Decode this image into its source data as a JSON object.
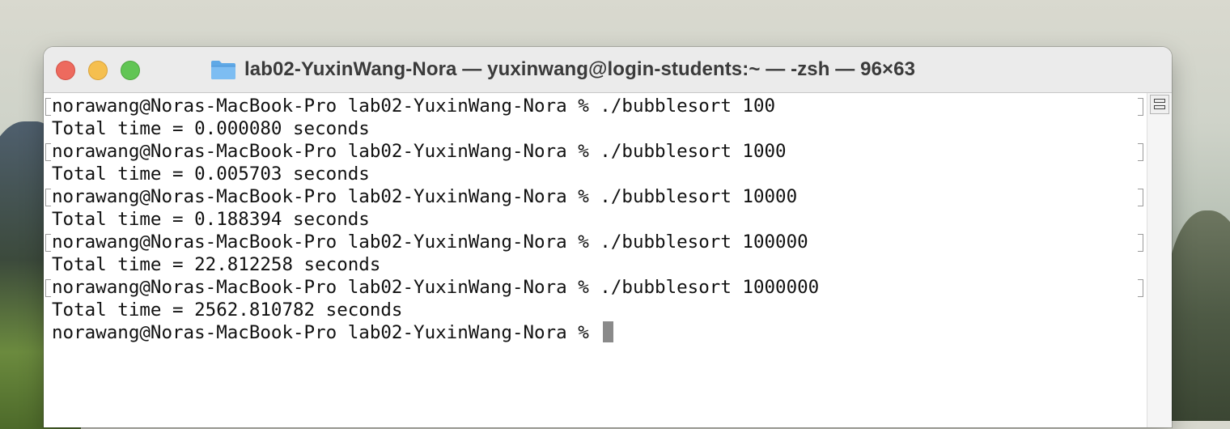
{
  "window": {
    "title": "lab02-YuxinWang-Nora — yuxinwang@login-students:~ — -zsh — 96×63",
    "folder_icon": "folder-icon",
    "traffic_lights": {
      "close_color": "#ed6a5e",
      "minimize_color": "#f5bf4f",
      "zoom_color": "#61c554"
    }
  },
  "terminal": {
    "lines": [
      {
        "text": "norawang@Noras-MacBook-Pro lab02-YuxinWang-Nora % ./bubblesort 100",
        "marked": true
      },
      {
        "text": "Total time = 0.000080 seconds",
        "marked": false
      },
      {
        "text": "norawang@Noras-MacBook-Pro lab02-YuxinWang-Nora % ./bubblesort 1000",
        "marked": true
      },
      {
        "text": "Total time = 0.005703 seconds",
        "marked": false
      },
      {
        "text": "norawang@Noras-MacBook-Pro lab02-YuxinWang-Nora % ./bubblesort 10000",
        "marked": true
      },
      {
        "text": "Total time = 0.188394 seconds",
        "marked": false
      },
      {
        "text": "norawang@Noras-MacBook-Pro lab02-YuxinWang-Nora % ./bubblesort 100000",
        "marked": true
      },
      {
        "text": "Total time = 22.812258 seconds",
        "marked": false
      },
      {
        "text": "norawang@Noras-MacBook-Pro lab02-YuxinWang-Nora % ./bubblesort 1000000",
        "marked": true
      },
      {
        "text": "Total time = 2562.810782 seconds",
        "marked": false
      }
    ],
    "prompt": "norawang@Noras-MacBook-Pro lab02-YuxinWang-Nora % "
  },
  "colors": {
    "terminal_background": "#ffffff",
    "text": "#111111",
    "cursor": "#8a8a8a"
  }
}
